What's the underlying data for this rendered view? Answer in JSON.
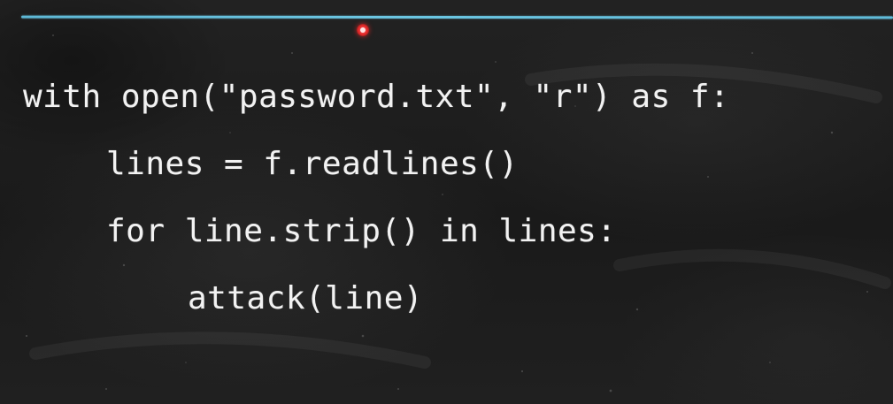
{
  "code": {
    "lines": [
      "with open(\"password.txt\", \"r\") as f:",
      "lines = f.readlines()",
      "for line.strip() in lines:",
      "attack(line)"
    ]
  },
  "colors": {
    "board": "#1d1d1d",
    "chalk_text": "#f2f2f2",
    "top_rule": "#6cc7e3",
    "pointer": "#e02424"
  }
}
